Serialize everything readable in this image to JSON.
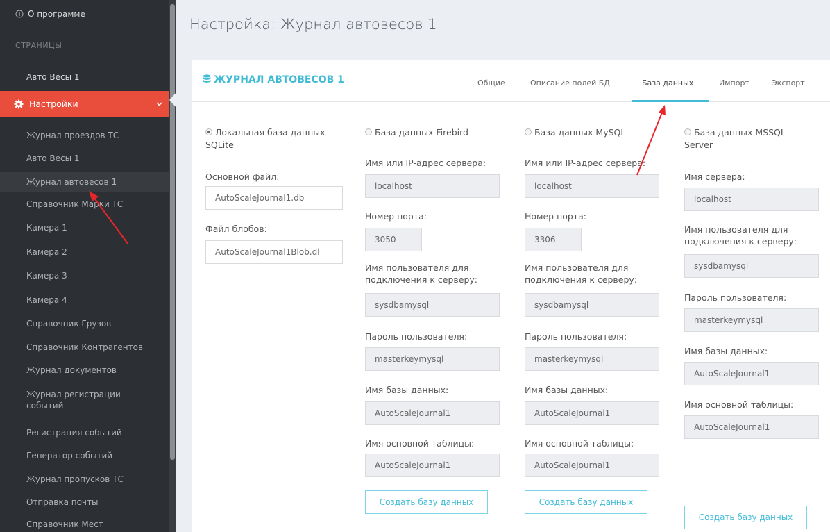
{
  "sidebar": {
    "about": "О программе",
    "pages_header": "СТРАНИЦЫ",
    "auto_scales": "Авто Весы 1",
    "settings": "Настройки",
    "items": [
      "Журнал проездов ТС",
      "Авто Весы 1",
      "Журнал автовесов 1",
      "Справочник Марки ТС",
      "Камера 1",
      "Камера 2",
      "Камера 3",
      "Камера 4",
      "Справочник Грузов",
      "Справочник Контрагентов",
      "Журнал документов",
      "Журнал регистрации событий",
      "Регистрация событий",
      "Генератор событий",
      "Журнал пропусков ТС",
      "Отправка почты",
      "Справочник Мест"
    ]
  },
  "page": {
    "title": "Настройка: Журнал автовесов 1"
  },
  "panel": {
    "title": "ЖУРНАЛ АВТОВЕСОВ 1",
    "tabs": [
      "Общие",
      "Описание полей БД",
      "База данных",
      "Импорт",
      "Экспорт"
    ],
    "active_tab": "База данных"
  },
  "sqlite": {
    "radio": "Локальная база данных SQLite",
    "main_file_label": "Основной файл:",
    "main_file": "AutoScaleJournal1.db",
    "blob_label": "Файл блобов:",
    "blob_file": "AutoScaleJournal1Blob.dl"
  },
  "firebird": {
    "radio": "База данных Firebird",
    "server_label": "Имя или IP-адрес сервера:",
    "server": "localhost",
    "port_label": "Номер порта:",
    "port": "3050",
    "user_label": "Имя пользователя для подключения к серверу:",
    "user": "sysdbamysql",
    "password_label": "Пароль пользователя:",
    "password": "masterkeymysql",
    "db_label": "Имя базы данных:",
    "db": "AutoScaleJournal1",
    "table_label": "Имя основной таблицы:",
    "table": "AutoScaleJournal1",
    "create_button": "Создать базу данных"
  },
  "mysql": {
    "radio": "База данных MySQL",
    "server_label": "Имя или IP-адрес сервера:",
    "server": "localhost",
    "port_label": "Номер порта:",
    "port": "3306",
    "user_label": "Имя пользователя для подключения к серверу:",
    "user": "sysdbamysql",
    "password_label": "Пароль пользователя:",
    "password": "masterkeymysql",
    "db_label": "Имя базы данных:",
    "db": "AutoScaleJournal1",
    "table_label": "Имя основной таблицы:",
    "table": "AutoScaleJournal1",
    "create_button": "Создать базу данных"
  },
  "mssql": {
    "radio": "База данных MSSQL Server",
    "server_label": "Имя сервера:",
    "server": "localhost",
    "user_label": "Имя пользователя для подключения к серверу:",
    "user": "sysdbamysql",
    "password_label": "Пароль пользователя:",
    "password": "masterkeymysql",
    "db_label": "Имя базы данных:",
    "db": "AutoScaleJournal1",
    "table_label": "Имя основной таблицы:",
    "table": "AutoScaleJournal1",
    "create_button": "Создать базу данных"
  },
  "colors": {
    "accent": "#42bcd6",
    "active_menu": "#e94e3d",
    "sidebar_bg": "#2c2f33",
    "annotation_arrow": "#e8262a"
  }
}
